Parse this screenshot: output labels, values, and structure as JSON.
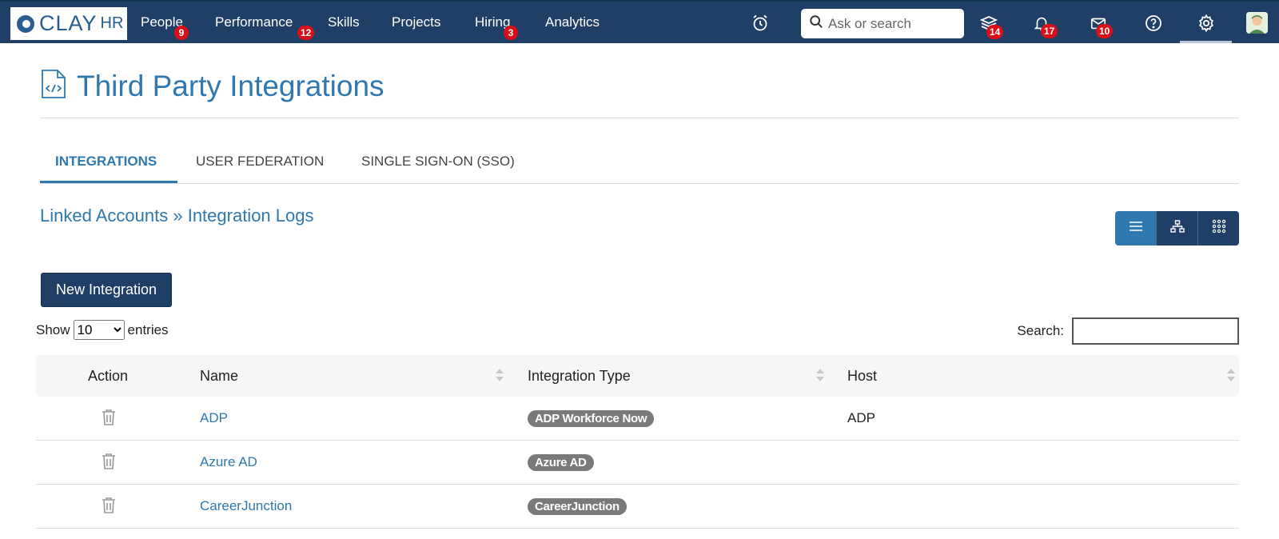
{
  "app": {
    "logo_text": "CLAY",
    "logo_sub": "HR"
  },
  "nav": {
    "items": [
      {
        "label": "People",
        "badge": "9"
      },
      {
        "label": "Performance",
        "badge": "12"
      },
      {
        "label": "Skills",
        "badge": ""
      },
      {
        "label": "Projects",
        "badge": ""
      },
      {
        "label": "Hiring",
        "badge": "3"
      },
      {
        "label": "Analytics",
        "badge": ""
      }
    ],
    "search_placeholder": "Ask or search",
    "icons": [
      {
        "name": "alarm-clock-icon",
        "badge": ""
      },
      {
        "name": "courses-stack-icon",
        "badge": "14"
      },
      {
        "name": "bell-icon",
        "badge": "17"
      },
      {
        "name": "mail-icon",
        "badge": "10"
      },
      {
        "name": "help-icon",
        "badge": ""
      },
      {
        "name": "gear-icon",
        "badge": ""
      }
    ]
  },
  "page": {
    "title": "Third Party Integrations",
    "icon": "code-file-icon"
  },
  "tabs": [
    {
      "label": "Integrations",
      "active": true
    },
    {
      "label": "User Federation",
      "active": false
    },
    {
      "label": "Single Sign-On (SSO)",
      "active": false
    }
  ],
  "breadcrumb": {
    "first": "Linked Accounts",
    "separator": " » ",
    "second": "Integration Logs"
  },
  "view_toggle": [
    "list-view-icon",
    "hierarchy-view-icon",
    "grid-view-icon"
  ],
  "new_button": "New Integration",
  "table_controls": {
    "show_label": "Show",
    "entries_value": "10",
    "entries_label": "entries",
    "search_label": "Search:"
  },
  "table": {
    "columns": [
      "Action",
      "Name",
      "Integration Type",
      "Host"
    ],
    "rows": [
      {
        "name": "ADP",
        "type": "ADP Workforce Now",
        "host": "ADP"
      },
      {
        "name": "Azure AD",
        "type": "Azure AD",
        "host": ""
      },
      {
        "name": "CareerJunction",
        "type": "CareerJunction",
        "host": ""
      }
    ]
  },
  "colors": {
    "nav_bg": "#1f3f66",
    "accent": "#2f78b0",
    "badge": "#d9101a",
    "tag": "#7a7a7a"
  }
}
